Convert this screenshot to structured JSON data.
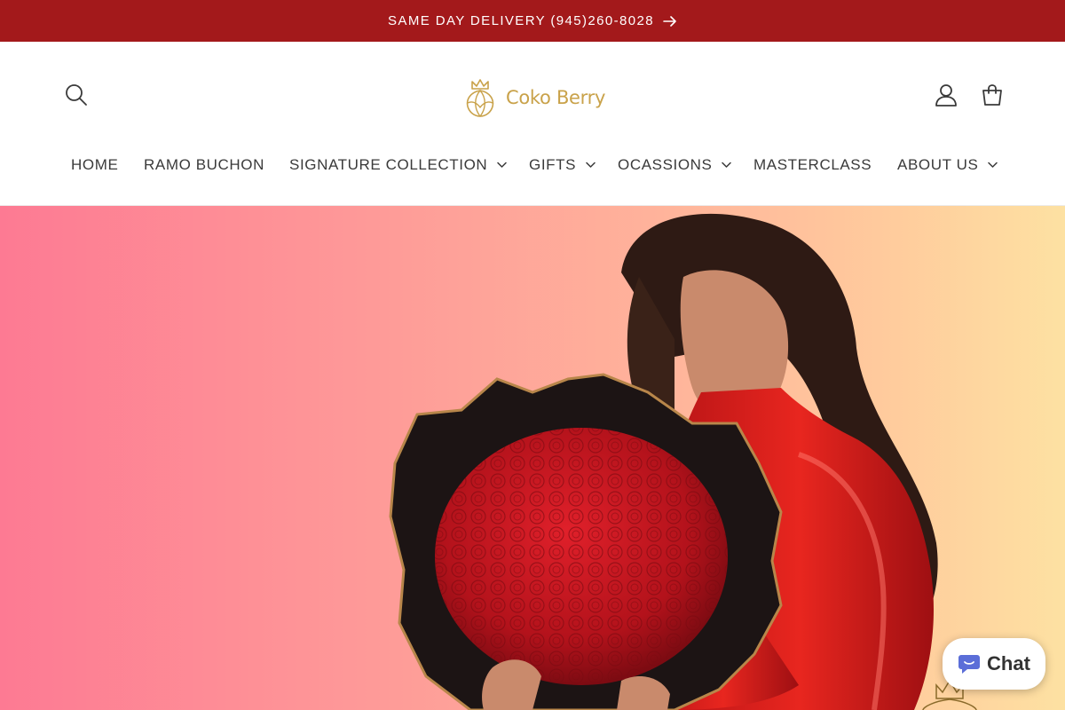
{
  "announcement": {
    "text": "SAME DAY DELIVERY (945)260-8028",
    "icon": "arrow-right-icon",
    "background": "#a3191b"
  },
  "header": {
    "logo_text": "Coko Berry",
    "brand_color": "#c9a24a",
    "icons": [
      "search-icon",
      "account-icon",
      "cart-icon"
    ]
  },
  "nav": {
    "items": [
      {
        "label": "HOME",
        "has_dropdown": false
      },
      {
        "label": "RAMO BUCHON",
        "has_dropdown": false
      },
      {
        "label": "SIGNATURE COLLECTION",
        "has_dropdown": true
      },
      {
        "label": "GIFTS",
        "has_dropdown": true
      },
      {
        "label": "OCASSIONS",
        "has_dropdown": true
      },
      {
        "label": "MASTERCLASS",
        "has_dropdown": false
      },
      {
        "label": "ABOUT US",
        "has_dropdown": true
      }
    ]
  },
  "hero": {
    "gradient": [
      "#fd7a93",
      "#ffb39b",
      "#fde1a2"
    ]
  },
  "chat": {
    "label": "Chat",
    "icon": "chat-bubble-icon",
    "color": "#5b6ed8"
  }
}
